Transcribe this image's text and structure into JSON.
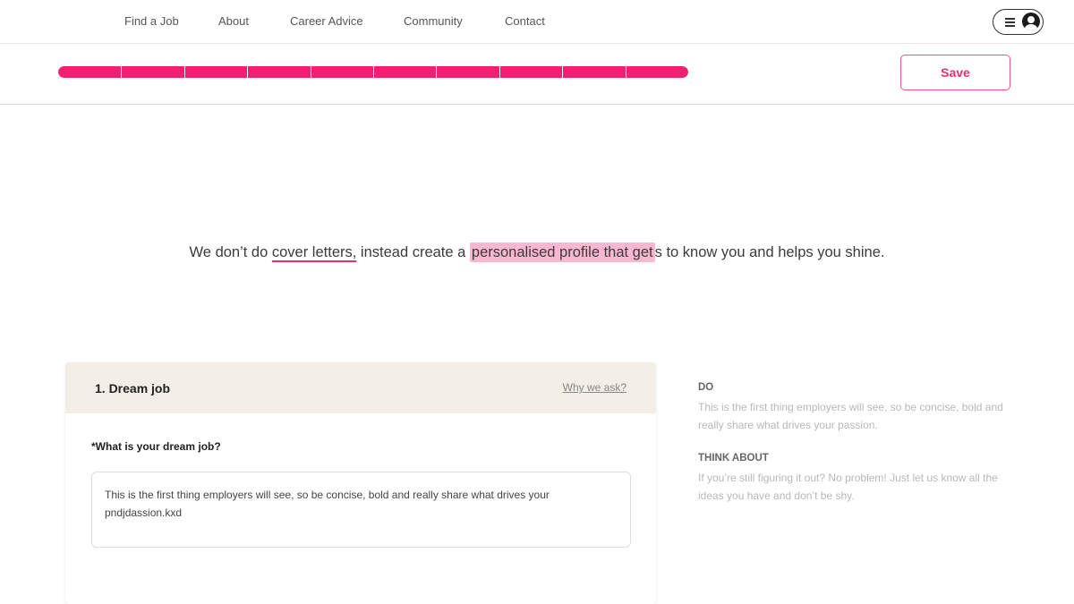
{
  "nav": {
    "links": [
      "Find a Job",
      "About",
      "Career Advice",
      "Community",
      "Contact"
    ]
  },
  "progress": {
    "segments_total": 10,
    "segments_completed": 10,
    "fraction": 1.0
  },
  "toolbar": {
    "save_label": "Save"
  },
  "headline": {
    "part1": "We don’t do ",
    "underlined": "cover letters,",
    "part2": " instead create a ",
    "highlighted": "personalised profile that get",
    "part3": "s to know you and helps you shine."
  },
  "card": {
    "title": "1. Dream job",
    "why_link": "Why we ask?",
    "field_label": "*What is your dream job?",
    "field_value": "This is the first thing employers will see, so be concise, bold and really share what drives your pndjdassion.kxd"
  },
  "tips": {
    "do_heading": "DO",
    "do_text": "This is the first thing employers will see, so be concise, bold and really share what drives your passion.",
    "think_heading": "THINK ABOUT",
    "think_text": "If you’re still figuring it out? No problem! Just let us know all the ideas you have and don’t be shy."
  },
  "colors": {
    "accent": "#f51f72",
    "highlight": "#f9b7d0",
    "card_header": "#f3eee6"
  },
  "icons": {
    "menu": "hamburger-icon",
    "profile": "user-avatar-icon"
  }
}
